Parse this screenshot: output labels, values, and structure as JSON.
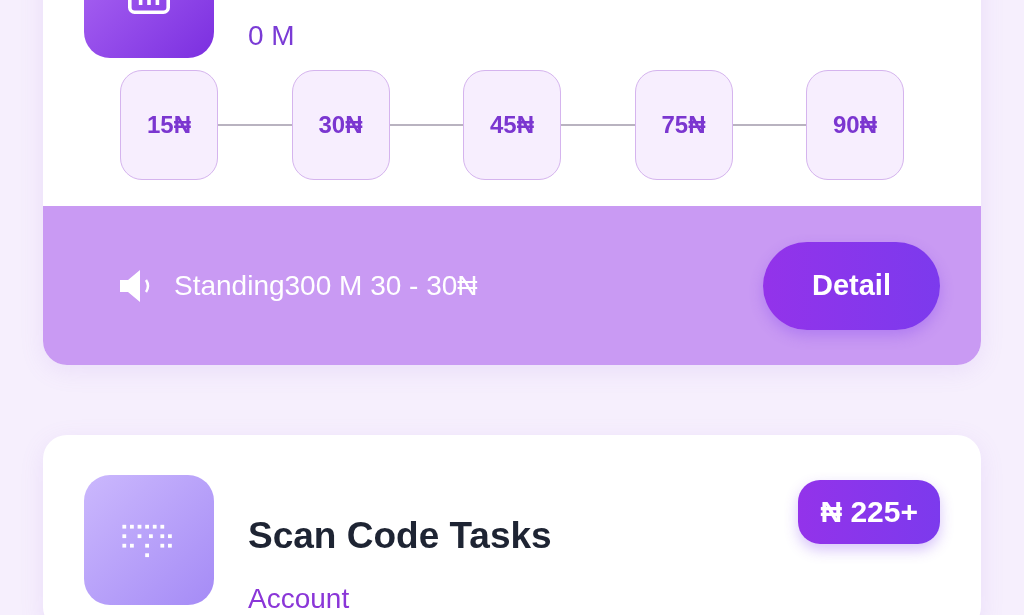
{
  "cards": [
    {
      "subtitle": "0 M",
      "steps": [
        "15₦",
        "30₦",
        "45₦",
        "75₦",
        "90₦"
      ],
      "notice": "Standing300 M 30 - 30₦",
      "button": "Detail"
    },
    {
      "title": "Scan Code Tasks",
      "badge": "₦ 225+",
      "subtitle": "Account"
    }
  ]
}
